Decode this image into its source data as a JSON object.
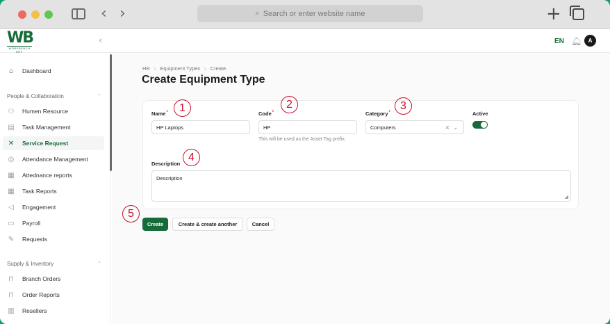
{
  "browser": {
    "address_placeholder": "Search or enter website name"
  },
  "header": {
    "logo_text": "WB",
    "logo_subtext": "WORKBENCH ERP",
    "language": "EN",
    "avatar_initial": "A"
  },
  "sidebar": {
    "dashboard": "Dashboard",
    "groups": [
      {
        "title": "People & Collaboration",
        "items": [
          {
            "label": "Humen Resource",
            "icon": "users-icon"
          },
          {
            "label": "Task Management",
            "icon": "clipboard-icon"
          },
          {
            "label": "Service Request",
            "icon": "tools-icon",
            "active": true
          },
          {
            "label": "Attendance Management",
            "icon": "fingerprint-icon"
          },
          {
            "label": "Attednance reports",
            "icon": "report-icon"
          },
          {
            "label": "Task Reports",
            "icon": "report-icon"
          },
          {
            "label": "Engagement",
            "icon": "megaphone-icon"
          },
          {
            "label": "Payroll",
            "icon": "payroll-icon"
          },
          {
            "label": "Requests",
            "icon": "edit-icon"
          }
        ]
      },
      {
        "title": "Supply & Inventory",
        "items": [
          {
            "label": "Branch Orders",
            "icon": "bag-icon"
          },
          {
            "label": "Order Reports",
            "icon": "bag-icon"
          },
          {
            "label": "Resellers",
            "icon": "store-icon"
          }
        ]
      }
    ]
  },
  "breadcrumb": [
    "HR",
    "Equipment Types",
    "Create"
  ],
  "page_title": "Create Equipment Type",
  "form": {
    "name": {
      "label": "Name",
      "value": "HP Laptops"
    },
    "code": {
      "label": "Code",
      "value": "HP",
      "hint": "This will be used as the Asset Tag prefix."
    },
    "category": {
      "label": "Category",
      "value": "Computers"
    },
    "active": {
      "label": "Active",
      "value": true
    },
    "description": {
      "label": "Description",
      "value": "Description"
    }
  },
  "markers": [
    "1",
    "2",
    "3",
    "4",
    "5"
  ],
  "actions": {
    "create": "Create",
    "create_another": "Create & create another",
    "cancel": "Cancel"
  },
  "colors": {
    "brand": "#176b3a",
    "marker": "#c8102e"
  }
}
